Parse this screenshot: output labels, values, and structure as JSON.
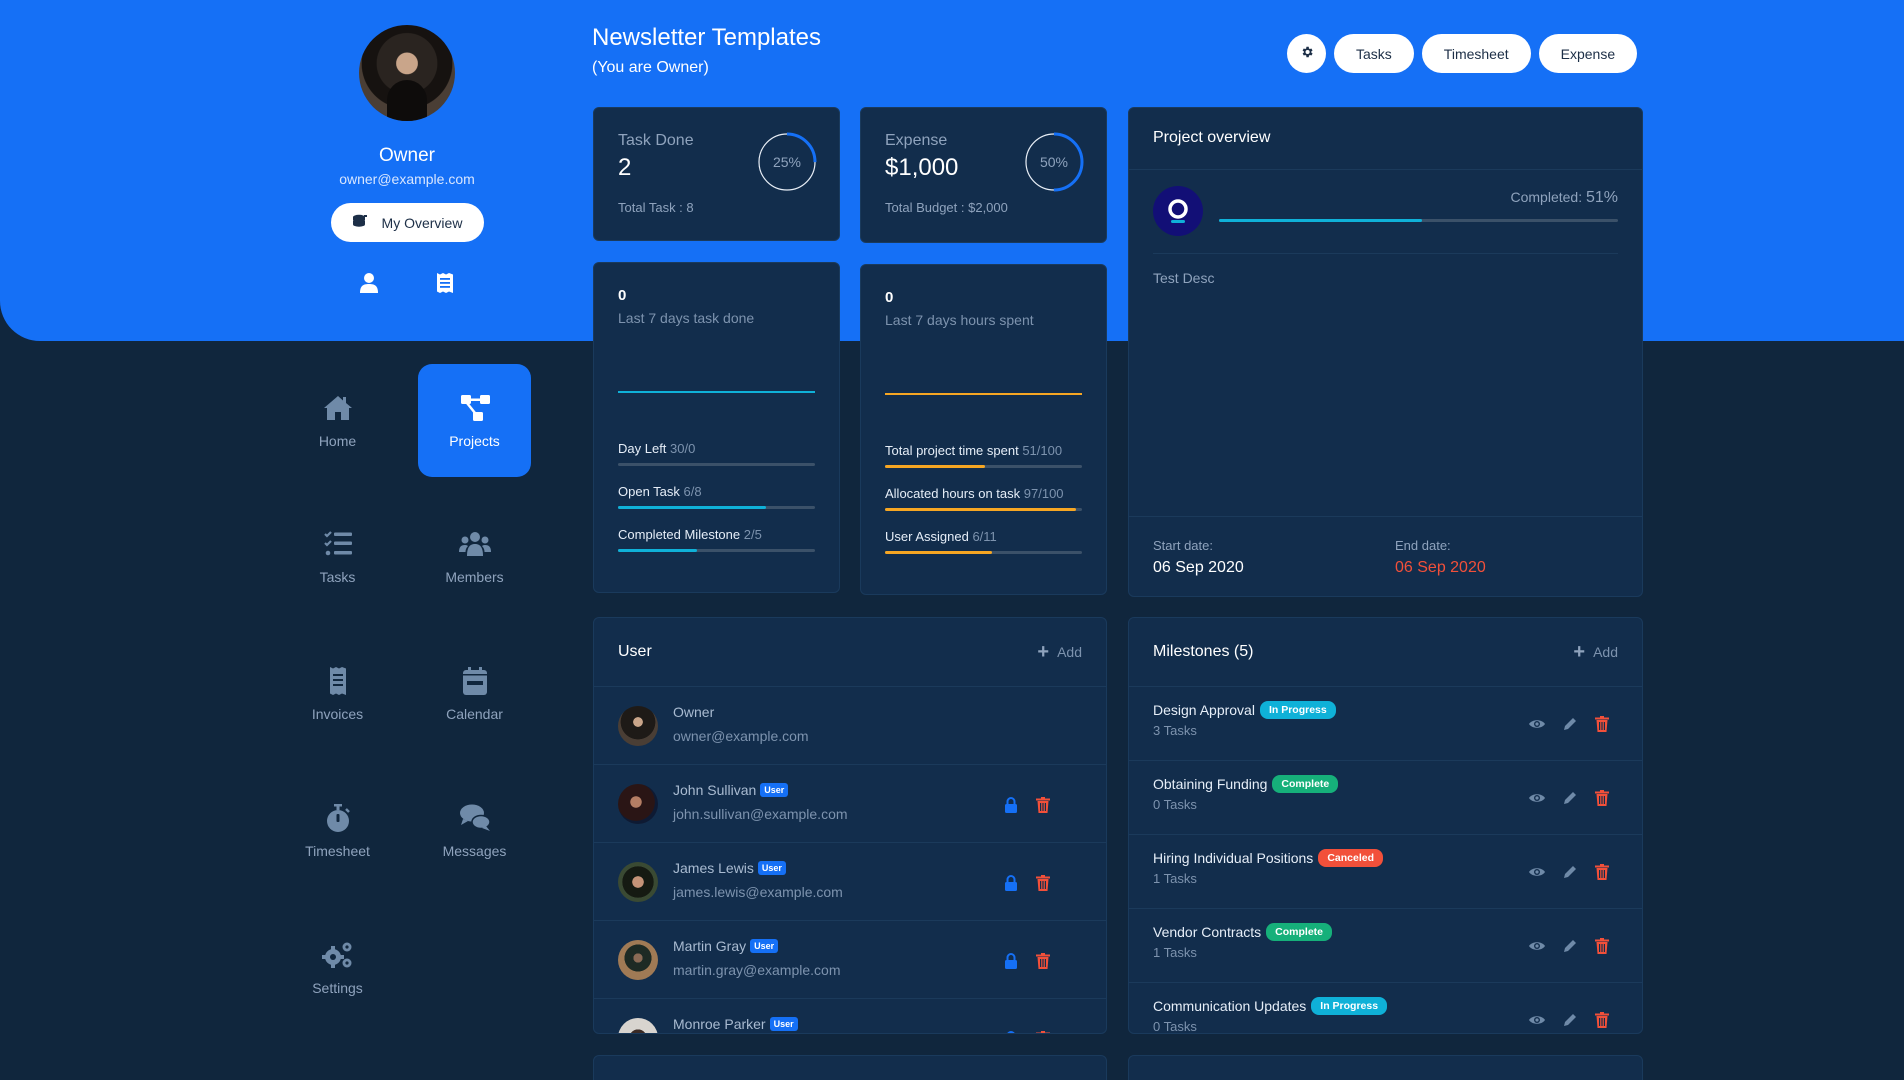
{
  "profile": {
    "name": "Owner",
    "email": "owner@example.com",
    "overview_button": "My Overview",
    "icons": [
      "user-icon",
      "receipt-icon"
    ]
  },
  "header": {
    "title": "Newsletter Templates",
    "subtitle": "(You are Owner)",
    "actions": [
      "Tasks",
      "Timesheet",
      "Expense"
    ]
  },
  "nav": [
    {
      "label": "Home",
      "icon": "home-icon",
      "active": false
    },
    {
      "label": "Projects",
      "icon": "projects-icon",
      "active": true
    },
    {
      "label": "Tasks",
      "icon": "tasks-icon",
      "active": false
    },
    {
      "label": "Members",
      "icon": "members-icon",
      "active": false
    },
    {
      "label": "Invoices",
      "icon": "invoice-icon",
      "active": false
    },
    {
      "label": "Calendar",
      "icon": "calendar-icon",
      "active": false
    },
    {
      "label": "Timesheet",
      "icon": "stopwatch-icon",
      "active": false
    },
    {
      "label": "Messages",
      "icon": "messages-icon",
      "active": false
    },
    {
      "label": "Settings",
      "icon": "settings-icon",
      "active": false
    }
  ],
  "task_card": {
    "label": "Task Done",
    "value": "2",
    "footer": "Total Task : 8",
    "percent_text": "25%",
    "percent": 25
  },
  "expense_card": {
    "label": "Expense",
    "value": "$1,000",
    "footer": "Total Budget : $2,000",
    "percent_text": "50%",
    "percent": 50
  },
  "task_activity": {
    "value": "0",
    "label": "Last 7 days task done",
    "bars": [
      {
        "label": "Day Left",
        "value": "30/0",
        "fraction": 0
      },
      {
        "label": "Open Task",
        "value": "6/8",
        "fraction": 0.75
      },
      {
        "label": "Completed Milestone",
        "value": "2/5",
        "fraction": 0.4
      }
    ]
  },
  "hours_activity": {
    "value": "0",
    "label": "Last 7 days hours spent",
    "bars": [
      {
        "label": "Total project time spent",
        "value": "51/100",
        "fraction": 0.51
      },
      {
        "label": "Allocated hours on task",
        "value": "97/100",
        "fraction": 0.97
      },
      {
        "label": "User Assigned",
        "value": "6/11",
        "fraction": 0.545
      }
    ]
  },
  "project_overview": {
    "title": "Project overview",
    "completed_label": "Completed:",
    "completed_value": "51%",
    "completed_fraction": 0.51,
    "description": "Test Desc",
    "start_label": "Start date:",
    "start_date": "06 Sep 2020",
    "end_label": "End date:",
    "end_date": "06 Sep 2020"
  },
  "users": {
    "title": "User",
    "add_label": "Add",
    "items": [
      {
        "name": "Owner",
        "email": "owner@example.com",
        "badge": "",
        "actions": false
      },
      {
        "name": "John Sullivan",
        "email": "john.sullivan@example.com",
        "badge": "User",
        "actions": true
      },
      {
        "name": "James Lewis",
        "email": "james.lewis@example.com",
        "badge": "User",
        "actions": true
      },
      {
        "name": "Martin Gray",
        "email": "martin.gray@example.com",
        "badge": "User",
        "actions": true
      },
      {
        "name": "Monroe Parker",
        "email": "",
        "badge": "User",
        "actions": true
      }
    ]
  },
  "milestones": {
    "title": "Milestones (5)",
    "add_label": "Add",
    "items": [
      {
        "name": "Design Approval",
        "status": "In Progress",
        "tasks": "3 Tasks"
      },
      {
        "name": "Obtaining Funding",
        "status": "Complete",
        "tasks": "0 Tasks"
      },
      {
        "name": "Hiring Individual Positions",
        "status": "Canceled",
        "tasks": "1 Tasks"
      },
      {
        "name": "Vendor Contracts",
        "status": "Complete",
        "tasks": "1 Tasks"
      },
      {
        "name": "Communication Updates",
        "status": "In Progress",
        "tasks": "0 Tasks"
      }
    ]
  },
  "colors": {
    "primary": "#1570f6",
    "background": "#10263d",
    "card": "#122d4c",
    "cyan": "#0fb1d8",
    "orange": "#f6a623",
    "danger": "#f2503a",
    "status_in_progress": "#0fb1d8",
    "status_complete": "#16b07a",
    "status_canceled": "#f2503a"
  }
}
